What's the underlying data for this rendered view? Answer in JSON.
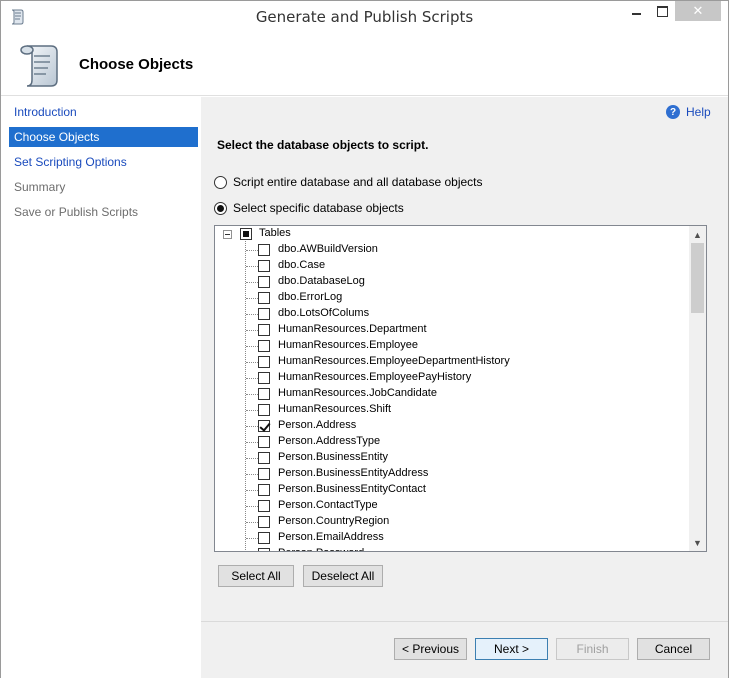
{
  "window": {
    "title": "Generate and Publish Scripts",
    "close_glyph": "✕"
  },
  "header": {
    "title": "Choose Objects"
  },
  "nav": {
    "items": [
      {
        "label": "Introduction",
        "state": "link"
      },
      {
        "label": "Choose Objects",
        "state": "active"
      },
      {
        "label": "Set Scripting Options",
        "state": "link"
      },
      {
        "label": "Summary",
        "state": "disabled"
      },
      {
        "label": "Save or Publish Scripts",
        "state": "disabled"
      }
    ]
  },
  "main": {
    "help_label": "Help",
    "help_glyph": "?",
    "instruction": "Select the database objects to script.",
    "radio_entire": "Script entire database and all database objects",
    "radio_specific": "Select specific database objects",
    "selected_radio": "specific"
  },
  "tree": {
    "root_label": "Tables",
    "root_state": "partial",
    "items": [
      {
        "label": "dbo.AWBuildVersion",
        "checked": false
      },
      {
        "label": "dbo.Case",
        "checked": false
      },
      {
        "label": "dbo.DatabaseLog",
        "checked": false
      },
      {
        "label": "dbo.ErrorLog",
        "checked": false
      },
      {
        "label": "dbo.LotsOfColums",
        "checked": false
      },
      {
        "label": "HumanResources.Department",
        "checked": false
      },
      {
        "label": "HumanResources.Employee",
        "checked": false
      },
      {
        "label": "HumanResources.EmployeeDepartmentHistory",
        "checked": false
      },
      {
        "label": "HumanResources.EmployeePayHistory",
        "checked": false
      },
      {
        "label": "HumanResources.JobCandidate",
        "checked": false
      },
      {
        "label": "HumanResources.Shift",
        "checked": false
      },
      {
        "label": "Person.Address",
        "checked": true
      },
      {
        "label": "Person.AddressType",
        "checked": false
      },
      {
        "label": "Person.BusinessEntity",
        "checked": false
      },
      {
        "label": "Person.BusinessEntityAddress",
        "checked": false
      },
      {
        "label": "Person.BusinessEntityContact",
        "checked": false
      },
      {
        "label": "Person.ContactType",
        "checked": false
      },
      {
        "label": "Person.CountryRegion",
        "checked": false
      },
      {
        "label": "Person.EmailAddress",
        "checked": false
      },
      {
        "label": "Person.Password",
        "checked": false
      }
    ]
  },
  "buttons": {
    "select_all": "Select All",
    "deselect_all": "Deselect All",
    "previous": "< Previous",
    "next": "Next >",
    "finish": "Finish",
    "cancel": "Cancel"
  }
}
